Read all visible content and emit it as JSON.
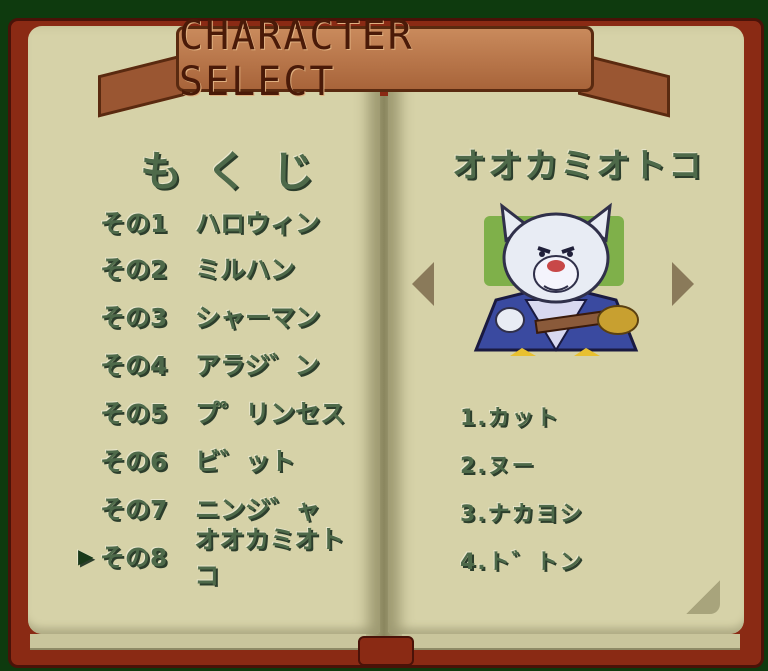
{
  "header": {
    "title": "CHARACTER SELECT"
  },
  "index": {
    "title": "もくじ"
  },
  "menu": [
    {
      "num": "その1",
      "name": "ハロウィン",
      "selected": false
    },
    {
      "num": "その2",
      "name": "ミルハン",
      "selected": false
    },
    {
      "num": "その3",
      "name": "シャーマン",
      "selected": false
    },
    {
      "num": "その4",
      "name": "アラジ゛ン",
      "selected": false
    },
    {
      "num": "その5",
      "name": "プ゜リンセス",
      "selected": false
    },
    {
      "num": "その6",
      "name": "ビ゛ット",
      "selected": false
    },
    {
      "num": "その7",
      "name": "ニンジ゛ャ",
      "selected": false
    },
    {
      "num": "その8",
      "name": "オオカミオトコ",
      "selected": true
    }
  ],
  "cursor": "▶",
  "character": {
    "name": "オオカミオトコ",
    "moves": [
      "1.カット",
      "2.ヌー",
      "3.ナカヨシ",
      "4.ト゛トン"
    ]
  },
  "icons": {
    "prev": "left-arrow-icon",
    "next": "right-arrow-icon"
  }
}
